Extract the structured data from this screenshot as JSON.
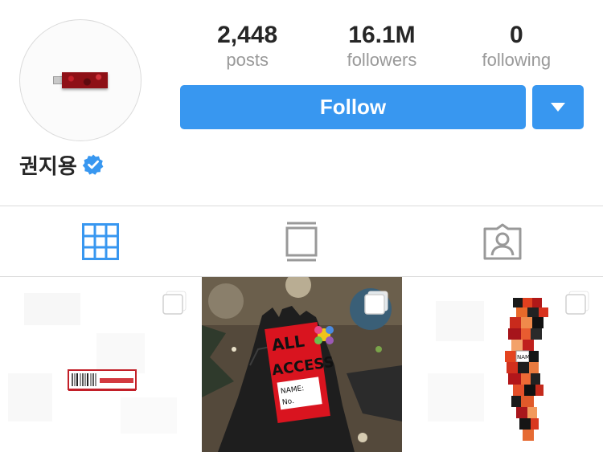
{
  "profile": {
    "name": "권지용",
    "verified": true
  },
  "stats": [
    {
      "value": "2,448",
      "label": "posts"
    },
    {
      "value": "16.1M",
      "label": "followers"
    },
    {
      "value": "0",
      "label": "following"
    }
  ],
  "actions": {
    "follow_label": "Follow"
  },
  "tabs": [
    {
      "icon": "grid-icon",
      "active": true
    },
    {
      "icon": "feed-icon",
      "active": false
    },
    {
      "icon": "tagged-icon",
      "active": false
    }
  ],
  "posts": [
    {
      "icon": "multiple-posts-icon"
    },
    {
      "icon": "multiple-posts-icon",
      "sticker_text": [
        "ALL",
        "ACCESS",
        "NAME:",
        "No."
      ]
    },
    {
      "icon": "multiple-posts-icon",
      "sticker_text": [
        "NAME"
      ]
    }
  ],
  "colors": {
    "accent": "#3897f0",
    "text": "#262626",
    "muted": "#999999",
    "border": "#dbdbdb"
  }
}
